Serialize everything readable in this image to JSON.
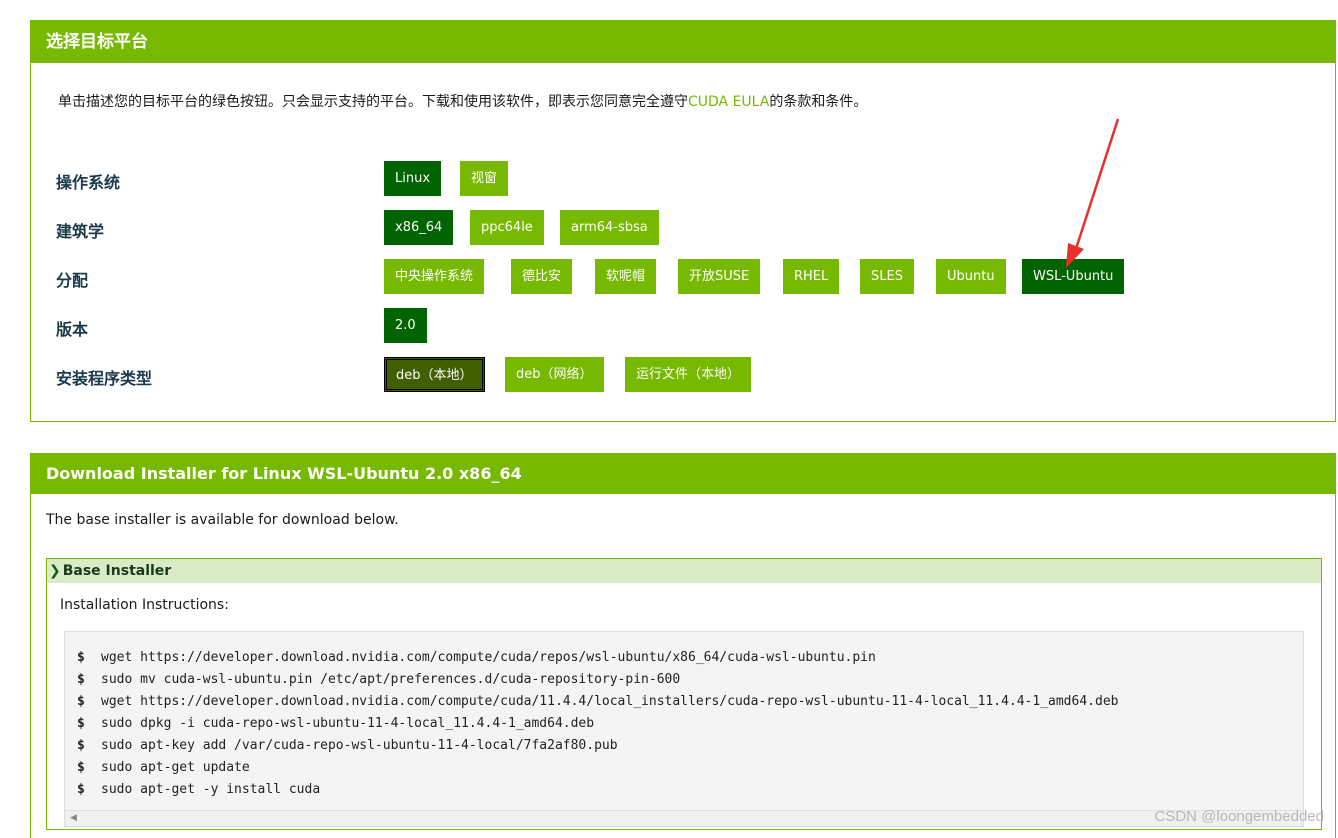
{
  "target_platform": {
    "title": "选择目标平台",
    "intro_before": "单击描述您的目标平台的绿色按钮。只会显示支持的平台。下载和使用该软件，即表示您同意完全遵守",
    "intro_link": "CUDA EULA",
    "intro_after": "的条款和条件。",
    "rows": {
      "os": {
        "label": "操作系统",
        "options": [
          "Linux",
          "视窗"
        ],
        "selected": "Linux"
      },
      "arch": {
        "label": "建筑学",
        "options": [
          "x86_64",
          "ppc64le",
          "arm64-sbsa"
        ],
        "selected": "x86_64"
      },
      "distro": {
        "label": "分配",
        "options": [
          "中央操作系统",
          "德比安",
          "软呢帽",
          "开放SUSE",
          "RHEL",
          "SLES",
          "Ubuntu",
          "WSL-Ubuntu"
        ],
        "selected": "WSL-Ubuntu"
      },
      "version": {
        "label": "版本",
        "options": [
          "2.0"
        ],
        "selected": "2.0"
      },
      "installer": {
        "label": "安装程序类型",
        "options": [
          "deb（本地）",
          "deb（网络）",
          "运行文件（本地）"
        ],
        "selected": "deb（本地）"
      }
    }
  },
  "download": {
    "title": "Download Installer for Linux WSL-Ubuntu 2.0 x86_64",
    "available_text": "The base installer is available for download below.",
    "base_installer": {
      "title": "Base Installer",
      "instructions_label": "Installation Instructions:",
      "prompt": "$",
      "commands": [
        "wget https://developer.download.nvidia.com/compute/cuda/repos/wsl-ubuntu/x86_64/cuda-wsl-ubuntu.pin",
        "sudo mv cuda-wsl-ubuntu.pin /etc/apt/preferences.d/cuda-repository-pin-600",
        "wget https://developer.download.nvidia.com/compute/cuda/11.4.4/local_installers/cuda-repo-wsl-ubuntu-11-4-local_11.4.4-1_amd64.deb",
        "sudo dpkg -i cuda-repo-wsl-ubuntu-11-4-local_11.4.4-1_amd64.deb",
        "sudo apt-key add /var/cuda-repo-wsl-ubuntu-11-4-local/7fa2af80.pub",
        "sudo apt-get update",
        "sudo apt-get -y install cuda"
      ]
    }
  },
  "watermark": "CSDN @loongembedded",
  "colors": {
    "accent": "#76b900",
    "selected": "#006400",
    "annotation_arrow": "#e8302a"
  },
  "icons": {
    "section_toggle": "chevron-right-icon",
    "scroll_left": "scroll-left-arrow-icon"
  }
}
